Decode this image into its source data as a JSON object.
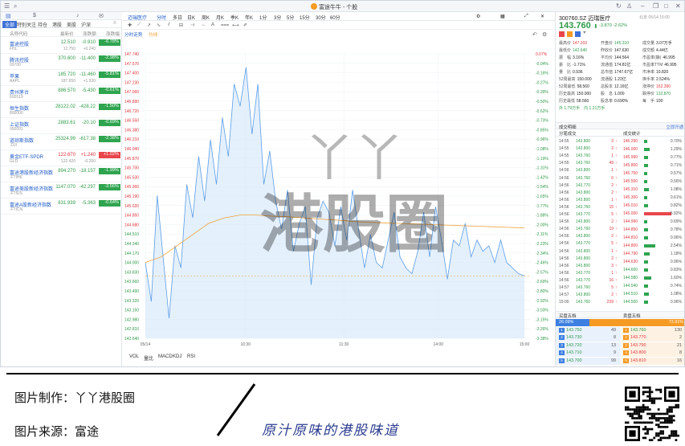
{
  "window": {
    "title": "富途牛牛 - 个股"
  },
  "watchlist": {
    "tabs": [
      "全部",
      "特别关注",
      "持仓",
      "港股",
      "美股",
      "沪深"
    ],
    "headers": {
      "name": "名称代码",
      "price": "最新价",
      "change": "涨跌额",
      "pct": "涨跌幅"
    },
    "rows": [
      {
        "name": "富途控股",
        "code": "FHL",
        "price": "12.510",
        "sub_price": "12.750",
        "chg": "-0.910",
        "sub_chg": "+0.240",
        "pct": "-6.78%",
        "up": false
      },
      {
        "name": "腾讯控股",
        "code": "00700",
        "price": "370.600",
        "sub_price": "",
        "chg": "-11.400",
        "sub_chg": "",
        "pct": "-2.98%",
        "up": false
      },
      {
        "name": "苹果",
        "code": "AAPL",
        "price": "185.720",
        "sub_price": "187.650",
        "chg": "-11.460",
        "sub_chg": "+1.930",
        "pct": "-5.81%",
        "up": false
      },
      {
        "name": "贵州茅台",
        "code": "600519",
        "price": "886.570",
        "sub_price": "",
        "chg": "-5.430",
        "sub_chg": "",
        "pct": "-0.61%",
        "up": false
      },
      {
        "name": "恒生指数",
        "code": "800000",
        "price": "28122.02",
        "sub_price": "",
        "chg": "-428.22",
        "sub_chg": "",
        "pct": "-1.50%",
        "up": false
      },
      {
        "name": "上证指数",
        "code": "000001",
        "price": "2883.61",
        "sub_price": "",
        "chg": "-20.10",
        "sub_chg": "",
        "pct": "-0.69%",
        "up": false
      },
      {
        "name": "道琼斯指数",
        "code": ".DJI",
        "price": "25324.99",
        "sub_price": "",
        "chg": "-617.38",
        "sub_chg": "",
        "pct": "-2.38%",
        "up": false
      },
      {
        "name": "黄金ETF-SPDR",
        "code": "GLD",
        "price": "122.670",
        "sub_price": "122.420",
        "chg": "+1.240",
        "sub_chg": "-0.250",
        "pct": "+1.02%",
        "up": true
      },
      {
        "name": "富途港股新经济指数",
        "code": ".FTIHK",
        "price": "894.270",
        "sub_price": "",
        "chg": "-18.157",
        "sub_chg": "",
        "pct": "-1.99%",
        "up": false
      },
      {
        "name": "富途美股新经济指数",
        "code": ".FTIUS",
        "price": "1147.070",
        "sub_price": "",
        "chg": "-42.297",
        "sub_chg": "",
        "pct": "-3.56%",
        "up": false
      },
      {
        "name": "富途A股新经济指数",
        "code": ".FTICN",
        "price": "831.939",
        "sub_price": "",
        "chg": "-5.363",
        "sub_chg": "",
        "pct": "-0.64%",
        "up": false
      }
    ]
  },
  "toolbar": {
    "items": [
      "迈瑞医疗",
      "分时",
      "多日",
      "日K",
      "周K",
      "月K",
      "季K",
      "年K",
      "1分",
      "3分",
      "5分",
      "15分",
      "30分",
      "60分"
    ],
    "active_index": 1,
    "legend_label": "分时走势",
    "avg_label": "均线"
  },
  "chart_data": {
    "type": "line",
    "xlabel": "",
    "ylabel": "",
    "x_ticks": [
      "05/14",
      "10:30",
      "11:30",
      "14:00",
      "15:00"
    ],
    "y_left_ticks": [
      "147.740",
      "147.570",
      "147.400",
      "147.230",
      "147.060",
      "146.890",
      "146.720",
      "146.550",
      "146.380",
      "146.210",
      "146.040",
      "145.870",
      "145.700",
      "145.530",
      "145.360",
      "145.190",
      "145.020",
      "144.850",
      "144.680",
      "144.510",
      "144.340",
      "144.170",
      "144.000",
      "143.830",
      "143.660",
      "143.490",
      "143.320",
      "143.150",
      "142.980",
      "142.810",
      "142.640"
    ],
    "y_right_ticks": [
      "0.07%",
      "-0.04%",
      "-0.16%",
      "-0.27%",
      "-0.39%",
      "-0.50%",
      "-0.62%",
      "-0.73%",
      "-0.85%",
      "-0.96%",
      "-1.08%",
      "-1.19%",
      "-1.31%",
      "-1.42%",
      "-1.54%",
      "-1.65%",
      "-1.77%",
      "-1.88%",
      "-2.00%",
      "-2.11%",
      "-2.23%",
      "-2.34%",
      "-2.46%",
      "-2.57%",
      "-2.69%",
      "-2.80%",
      "-2.92%",
      "-3.03%",
      "-3.15%",
      "-3.26%",
      "-3.38%"
    ],
    "y_range": [
      142.64,
      147.74
    ],
    "current_price": 143.76,
    "price_series": [
      144.0,
      143.3,
      145.2,
      144.1,
      143.0,
      144.3,
      143.9,
      145.4,
      144.8,
      145.9,
      145.1,
      146.2,
      145.4,
      146.6,
      145.9,
      147.2,
      146.8,
      147.5,
      146.3,
      147.2,
      145.4,
      146.0,
      145.1,
      144.6,
      145.3,
      144.2,
      144.7,
      145.0,
      143.6,
      144.8,
      145.1,
      144.9,
      144.3,
      145.0,
      144.4,
      145.3,
      144.6,
      143.9,
      144.5,
      144.0,
      143.9,
      144.4,
      144.9,
      144.1,
      143.9,
      143.8,
      144.2,
      144.9,
      144.1,
      145.0,
      144.4,
      143.7,
      144.4,
      144.3,
      144.7,
      144.1,
      144.4,
      144.2,
      144.3,
      144.0,
      144.4,
      144.0,
      143.9,
      143.8,
      143.76
    ],
    "avg_series": [
      144.0,
      144.1,
      144.3,
      144.5,
      144.7,
      144.8,
      144.85,
      144.85,
      144.83,
      144.82,
      144.8,
      144.78,
      144.76,
      144.74,
      144.72,
      144.71,
      144.7,
      144.69,
      144.68,
      144.67,
      144.66,
      144.65,
      144.64,
      144.63,
      144.62
    ],
    "indicators": [
      "VOL",
      "量比",
      "MACD",
      "KDJ",
      "RSI"
    ]
  },
  "quote": {
    "code": "300760.SZ",
    "name": "迈瑞医疗",
    "price": "143.760",
    "change": "-3.870 -2.62%",
    "date": "北京 05/14 15:00",
    "fields": [
      [
        "最高价",
        "147.310",
        "开盘价",
        "145.310",
        "成交量",
        "3.07万手"
      ],
      [
        "最低价",
        "142.640",
        "昨收价",
        "147.630",
        "成交额",
        "4.44亿"
      ],
      [
        "振　幅",
        "3.16%",
        "平均价",
        "144.564",
        "市盈率(静)",
        "46.995"
      ],
      [
        "委　比",
        "-1.71%",
        "流通值",
        "174.81亿",
        "市盈率TTM",
        "46.995"
      ],
      [
        "量　比",
        "0.936",
        "总市值",
        "1747.67亿",
        "市净率",
        "10.820"
      ],
      [
        "52周最高",
        "150.000",
        "流通股",
        "1.22亿",
        "换手率",
        "2.524%"
      ],
      [
        "52周最低",
        "58.560",
        "总股本",
        "12.16亿",
        "涨停价",
        "162.390"
      ],
      [
        "历史最高",
        "150.000",
        "股　息",
        "1.000",
        "跌停价",
        "132.870"
      ],
      [
        "历史最低",
        "58.560",
        "股息率",
        "0.690%",
        "每　手",
        "100"
      ]
    ],
    "inner_outer": "外 1.79万手　内 1.21万手"
  },
  "ticks_section": {
    "title": "成交明细",
    "right_title": "立即开通",
    "broker_title": "分笔成交",
    "stats_title": "成交统计",
    "ticks": [
      [
        "14:55",
        "143.800",
        "3"
      ],
      [
        "14:55",
        "143.800",
        "2"
      ],
      [
        "14:55",
        "143.760",
        "1"
      ],
      [
        "14:55",
        "143.760",
        "49"
      ],
      [
        "14:56",
        "143.800",
        "1"
      ],
      [
        "14:56",
        "143.760",
        "6"
      ],
      [
        "14:56",
        "143.770",
        "2"
      ],
      [
        "14:56",
        "143.800",
        "2"
      ],
      [
        "14:56",
        "143.800",
        "1"
      ],
      [
        "14:56",
        "143.760",
        "15"
      ],
      [
        "14:56",
        "143.770",
        "5"
      ],
      [
        "14:56",
        "143.800",
        "2"
      ],
      [
        "14:56",
        "143.760",
        "19"
      ],
      [
        "14:56",
        "143.800",
        "2"
      ],
      [
        "14:56",
        "143.770",
        "5"
      ],
      [
        "14:56",
        "143.800",
        "1"
      ],
      [
        "14:56",
        "143.800",
        "2"
      ],
      [
        "14:56",
        "143.800",
        "3"
      ],
      [
        "14:56",
        "143.770",
        "1"
      ],
      [
        "14:56",
        "143.770",
        "16"
      ],
      [
        "14:57",
        "143.760",
        "5"
      ],
      [
        "14:57",
        "143.800",
        "2"
      ],
      [
        "15:00",
        "143.760",
        "239"
      ]
    ],
    "stats": [
      [
        "146.290",
        "0.70%",
        4
      ],
      [
        "146.000",
        "1.29%",
        8
      ],
      [
        "145.990",
        "0.77%",
        5
      ],
      [
        "145.800",
        "0.71%",
        5
      ],
      [
        "145.750",
        "0.57%",
        4
      ],
      [
        "145.500",
        "0.56%",
        4
      ],
      [
        "145.310",
        "1.08%",
        7
      ],
      [
        "145.300",
        "0.61%",
        4
      ],
      [
        "145.010",
        "0.82%",
        5
      ],
      [
        "145.000",
        "5.92%",
        38
      ],
      [
        "144.990",
        "0.69%",
        4
      ],
      [
        "144.850",
        "0.78%",
        5
      ],
      [
        "144.810",
        "0.96%",
        6
      ],
      [
        "144.800",
        "2.54%",
        16
      ],
      [
        "144.790",
        "1.18%",
        8
      ],
      [
        "144.630",
        "0.96%",
        6
      ],
      [
        "144.600",
        "0.83%",
        5
      ],
      [
        "144.580",
        "1.60%",
        10
      ],
      [
        "144.540",
        "0.74%",
        5
      ],
      [
        "144.510",
        "1.08%",
        7
      ],
      [
        "144.500",
        "0.96%",
        6
      ]
    ]
  },
  "orderbook": {
    "buy_title": "买盘五档",
    "sell_title": "卖盘五档",
    "buy_pct": "26.09%",
    "sell_pct": "73.91%",
    "bids": [
      [
        "143.750",
        "49"
      ],
      [
        "143.730",
        "8"
      ],
      [
        "143.720",
        "13"
      ],
      [
        "143.710",
        "9"
      ],
      [
        "143.700",
        "99"
      ]
    ],
    "asks": [
      [
        "143.760",
        "130"
      ],
      [
        "143.770",
        "2"
      ],
      [
        "143.790",
        "21"
      ],
      [
        "143.800",
        "8"
      ],
      [
        "143.810",
        "16"
      ]
    ]
  },
  "watermark": {
    "line1": "丫丫",
    "line2": "港股圈"
  },
  "footer": {
    "maker": "图片制作：丫丫港股圈",
    "source": "图片来源：富途",
    "slogan": "原汁原味的港股味道"
  }
}
